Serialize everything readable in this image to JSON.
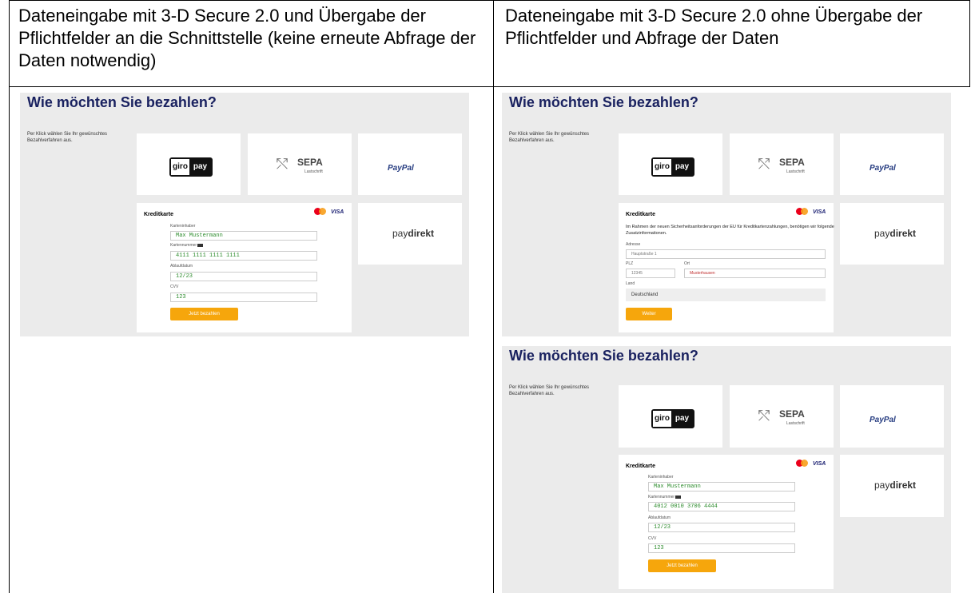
{
  "columns": [
    {
      "header": "Dateneingabe mit 3-D Secure 2.0 und Übergabe der Pflichtfelder an die Schnittstelle (keine erneute Abfrage der Daten notwendig)"
    },
    {
      "header": "Dateneingabe mit 3-D Secure 2.0 ohne Übergabe der Pflichtfelder und Abfrage der Daten"
    }
  ],
  "screenshots": [
    {
      "title": "Wie möchten Sie bezahlen?",
      "hint": "Per Klick wählen Sie Ihr gewünschtes Bezahlverfahren aus.",
      "methods": {
        "giro_left": "giro",
        "giro_right": "pay",
        "sepa": "SEPA",
        "sepa_sub": "Lastschrift",
        "paypal_a": "PayPal",
        "paydirekt_a": "pay",
        "paydirekt_b": "direkt"
      },
      "card": {
        "heading": "Kreditkarte",
        "visa": "VISA",
        "holder_label": "Karteninhaber",
        "holder_value": "Max Mustermann",
        "number_label": "Kartennummer",
        "number_value": "4111 1111 1111 1111",
        "expiry_label": "Ablaufdatum",
        "expiry_value": "12/23",
        "cvv_label": "CVV",
        "cvv_value": "123",
        "button": "Jetzt bezahlen"
      }
    },
    {
      "title": "Wie möchten Sie bezahlen?",
      "hint": "Per Klick wählen Sie Ihr gewünschtes Bezahlverfahren aus.",
      "methods": {
        "giro_left": "giro",
        "giro_right": "pay",
        "sepa": "SEPA",
        "sepa_sub": "Lastschrift",
        "paypal_a": "PayPal",
        "paydirekt_a": "pay",
        "paydirekt_b": "direkt"
      },
      "card": {
        "heading": "Kreditkarte",
        "visa": "VISA",
        "note": "Im Rahmen der neuen Sicherheitsanforderungen der EU für Kreditkartenzahlungen, benötigen wir folgende Zusatzinformationen.",
        "address_label": "Adresse",
        "address_value": "Hauptstraße 1",
        "zip_label": "PLZ",
        "zip_value": "12345",
        "city_label": "Ort",
        "city_value": "Musterhausen",
        "country_label": "Land",
        "country_value": "Deutschland",
        "button": "Weiter"
      }
    },
    {
      "title": "Wie möchten Sie bezahlen?",
      "hint": "Per Klick wählen Sie Ihr gewünschtes Bezahlverfahren aus.",
      "methods": {
        "giro_left": "giro",
        "giro_right": "pay",
        "sepa": "SEPA",
        "sepa_sub": "Lastschrift",
        "paypal_a": "PayPal",
        "paydirekt_a": "pay",
        "paydirekt_b": "direkt"
      },
      "card": {
        "heading": "Kreditkarte",
        "visa": "VISA",
        "holder_label": "Karteninhaber",
        "holder_value": "Max Mustermann",
        "number_label": "Kartennummer",
        "number_value": "4012 0010 3706 4444",
        "expiry_label": "Ablaufdatum",
        "expiry_value": "12/23",
        "cvv_label": "CVV",
        "cvv_value": "123",
        "button": "Jetzt bezahlen"
      }
    }
  ]
}
